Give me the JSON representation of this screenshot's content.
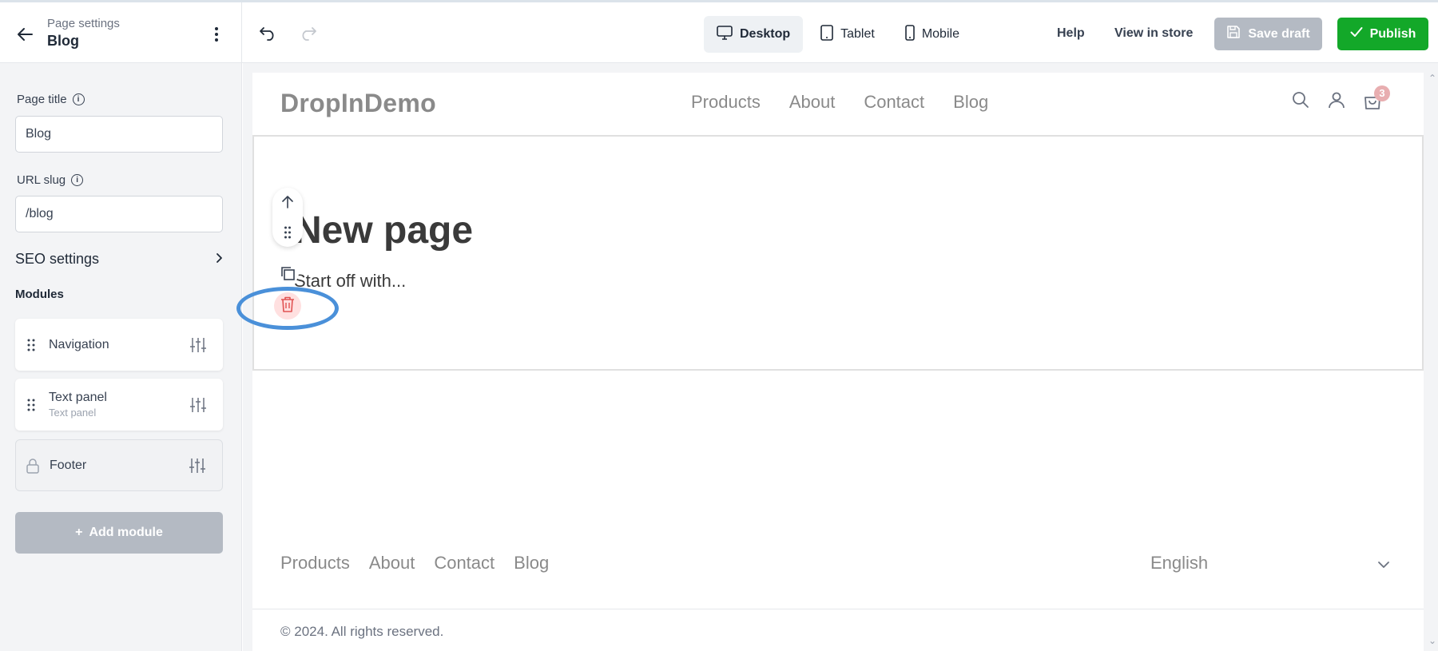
{
  "header": {
    "subtitle": "Page settings",
    "title": "Blog",
    "devices": [
      {
        "label": "Desktop",
        "icon": "desktop-icon",
        "active": true
      },
      {
        "label": "Tablet",
        "icon": "tablet-icon",
        "active": false
      },
      {
        "label": "Mobile",
        "icon": "mobile-icon",
        "active": false
      }
    ],
    "help": "Help",
    "view_in_store": "View in store",
    "save_draft": "Save draft",
    "publish": "Publish"
  },
  "sidebar": {
    "page_title_label": "Page title",
    "page_title_value": "Blog",
    "url_slug_label": "URL slug",
    "url_slug_value": "/blog",
    "seo_label": "SEO settings",
    "modules_heading": "Modules",
    "modules": [
      {
        "name": "Navigation",
        "sub": ""
      },
      {
        "name": "Text panel",
        "sub": "Text panel"
      },
      {
        "name": "Footer",
        "sub": "",
        "locked": true
      }
    ],
    "add_module": "Add module"
  },
  "preview": {
    "logo": "DropInDemo",
    "nav": [
      "Products",
      "About",
      "Contact",
      "Blog"
    ],
    "cart_count": "3",
    "heading": "New page",
    "body": "Start off with...",
    "footer_nav": [
      "Products",
      "About",
      "Contact",
      "Blog"
    ],
    "language": "English",
    "copyright": "© 2024. All rights reserved."
  },
  "colors": {
    "publish": "#13a829",
    "disabled": "#b4bac3",
    "highlight": "#4a90d9",
    "delete_bg": "#ffe0e0",
    "delete_icon": "#e05252"
  }
}
